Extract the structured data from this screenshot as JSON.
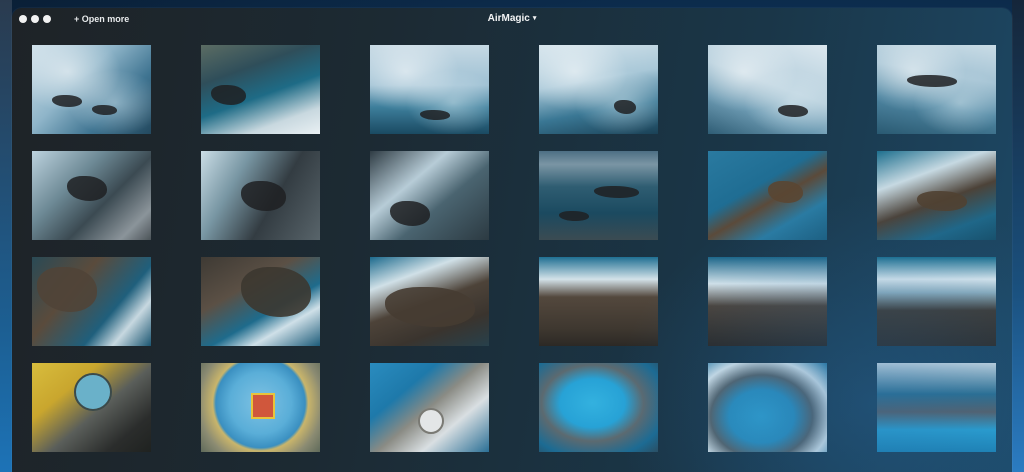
{
  "window": {
    "title": "AirMagic",
    "title_caret": "▾",
    "open_more_label": "+ Open more"
  },
  "thumbnails": [
    {
      "id": 1
    },
    {
      "id": 2
    },
    {
      "id": 3
    },
    {
      "id": 4
    },
    {
      "id": 5
    },
    {
      "id": 6
    },
    {
      "id": 7
    },
    {
      "id": 8
    },
    {
      "id": 9
    },
    {
      "id": 10
    },
    {
      "id": 11
    },
    {
      "id": 12
    },
    {
      "id": 13
    },
    {
      "id": 14
    },
    {
      "id": 15
    },
    {
      "id": 16
    },
    {
      "id": 17
    },
    {
      "id": 18
    },
    {
      "id": 19
    },
    {
      "id": 20
    },
    {
      "id": 21
    },
    {
      "id": 22
    },
    {
      "id": 23
    },
    {
      "id": 24
    }
  ]
}
